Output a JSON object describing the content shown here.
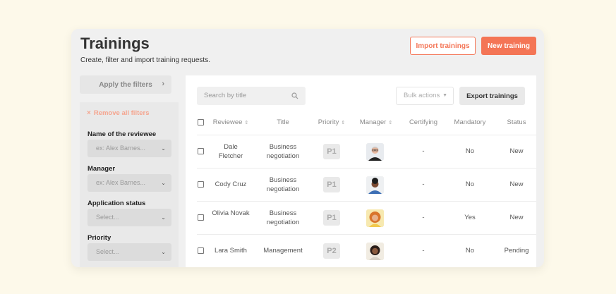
{
  "header": {
    "title": "Trainings",
    "subtitle": "Create, filter and import training requests.",
    "import_label": "Import trainings",
    "new_label": "New training"
  },
  "colors": {
    "accent": "#f47556",
    "background": "#fdf9ea",
    "card": "#f0f0f0"
  },
  "sidebar": {
    "apply_label": "Apply the filters",
    "remove_all_label": "Remove all filters",
    "filters": [
      {
        "label": "Name of the reviewee",
        "placeholder": "ex: Alex Barnes..."
      },
      {
        "label": "Manager",
        "placeholder": "ex: Alex Barnes..."
      },
      {
        "label": "Application status",
        "placeholder": "Select..."
      },
      {
        "label": "Priority",
        "placeholder": "Select..."
      }
    ]
  },
  "toolbar": {
    "search_placeholder": "Search by title",
    "bulk_label": "Bulk actions",
    "export_label": "Export trainings"
  },
  "table": {
    "columns": {
      "reviewee": "Reviewee",
      "title": "Title",
      "priority": "Priority",
      "manager": "Manager",
      "certifying": "Certifying",
      "mandatory": "Mandatory",
      "status": "Status"
    },
    "rows": [
      {
        "reviewee": "Dale Fletcher",
        "title": "Business negotiation",
        "priority": "P1",
        "manager_avatar": "man-glasses-avatar",
        "certifying": "-",
        "mandatory": "No",
        "status": "New"
      },
      {
        "reviewee": "Cody Cruz",
        "title": "Business negotiation",
        "priority": "P1",
        "manager_avatar": "man-curly-hair-avatar",
        "certifying": "-",
        "mandatory": "No",
        "status": "New"
      },
      {
        "reviewee": "Olivia Novak",
        "title": "Business negotiation",
        "priority": "P1",
        "manager_avatar": "woman-curly-hair-avatar",
        "certifying": "-",
        "mandatory": "Yes",
        "status": "New"
      },
      {
        "reviewee": "Lara Smith",
        "title": "Management",
        "priority": "P2",
        "manager_avatar": "woman-dark-hair-avatar",
        "certifying": "-",
        "mandatory": "No",
        "status": "Pending"
      }
    ]
  }
}
